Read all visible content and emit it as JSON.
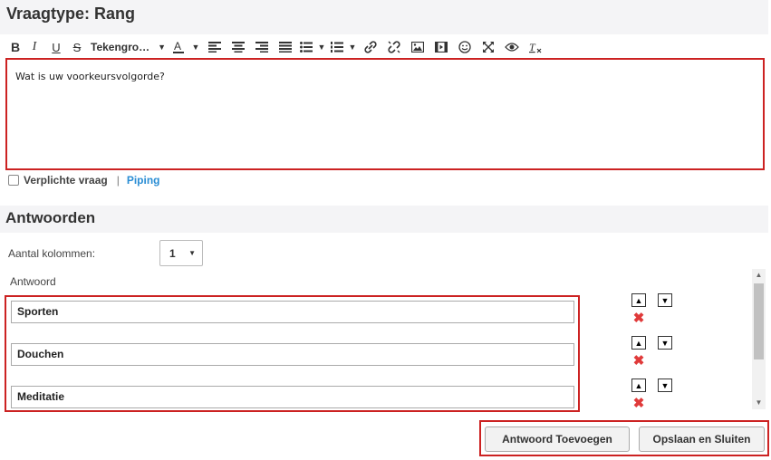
{
  "title": "Vraagtype: Rang",
  "toolbar": {
    "items": [
      {
        "name": "bold-icon",
        "glyph": "B"
      },
      {
        "name": "italic-icon",
        "glyph": "I"
      },
      {
        "name": "underline-icon",
        "glyph": "U"
      },
      {
        "name": "strikethrough-icon",
        "glyph": "S"
      }
    ],
    "font_size_label": "Tekengro…"
  },
  "editor": {
    "content": "Wat is uw voorkeursvolgorde?"
  },
  "required": {
    "label": "Verplichte vraag",
    "separator": "|",
    "piping_label": "Piping"
  },
  "answers_section": {
    "title": "Antwoorden",
    "columns_label": "Aantal kolommen:",
    "columns_value": "1",
    "answer_label": "Antwoord",
    "items": [
      "Sporten",
      "Douchen",
      "Meditatie"
    ]
  },
  "buttons": {
    "add_answer": "Antwoord Toevoegen",
    "save_close": "Opslaan en Sluiten"
  },
  "colors": {
    "highlight_border": "#cc2222",
    "link": "#2a8dd4",
    "delete": "#e03a3a"
  }
}
